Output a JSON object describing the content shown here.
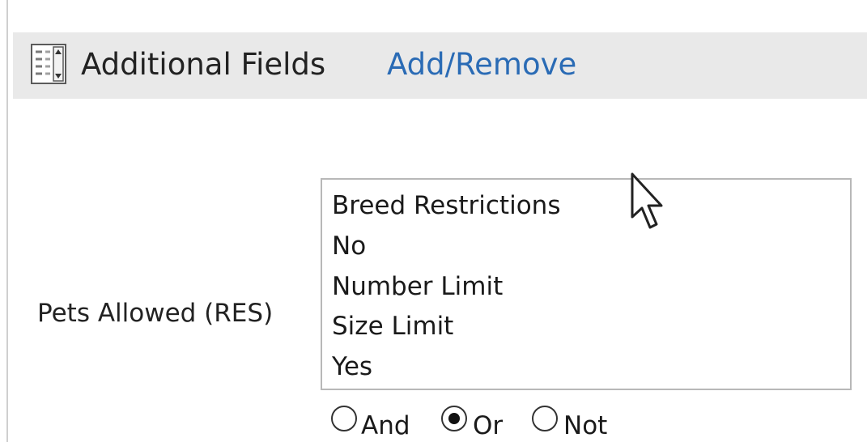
{
  "header": {
    "title": "Additional Fields",
    "link_label": "Add/Remove"
  },
  "field": {
    "label": "Pets Allowed (RES)",
    "options": [
      "Breed Restrictions",
      "No",
      "Number Limit",
      "Size Limit",
      "Yes"
    ]
  },
  "logic": {
    "options": [
      {
        "label": "And",
        "selected": false
      },
      {
        "label": "Or",
        "selected": true
      },
      {
        "label": "Not",
        "selected": false
      }
    ]
  },
  "colors": {
    "header_background": "#e9e9e9",
    "link": "#2a6bb5",
    "text": "#222222"
  },
  "icons": {
    "header": "fields-list-icon",
    "pointer": "mouse-cursor-icon"
  }
}
